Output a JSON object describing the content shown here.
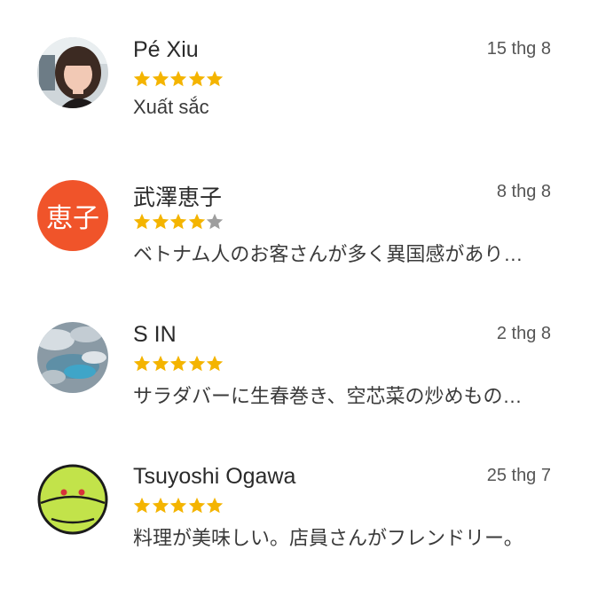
{
  "colors": {
    "star_filled": "#f4b400",
    "star_empty": "#9e9e9e",
    "monogram_bg": "#f0542a",
    "haro_green": "#c2e34a"
  },
  "reviews": [
    {
      "name": "Pé Xiu",
      "date": "15 thg 8",
      "rating": 5,
      "text": "Xuất sắc",
      "avatar": "photo-woman"
    },
    {
      "name": "武澤恵子",
      "date": "8 thg 8",
      "rating": 4,
      "text": "ベトナム人のお客さんが多く異国感があり…",
      "avatar": "monogram",
      "monogram": "恵子"
    },
    {
      "name": "S IN",
      "date": "2 thg 8",
      "rating": 5,
      "text": "サラダバーに生春巻き、空芯菜の炒めもの…",
      "avatar": "aerial-photo"
    },
    {
      "name": "Tsuyoshi Ogawa",
      "date": "25 thg 7",
      "rating": 5,
      "text": "料理が美味しい。店員さんがフレンドリー。",
      "avatar": "green-robot"
    }
  ]
}
